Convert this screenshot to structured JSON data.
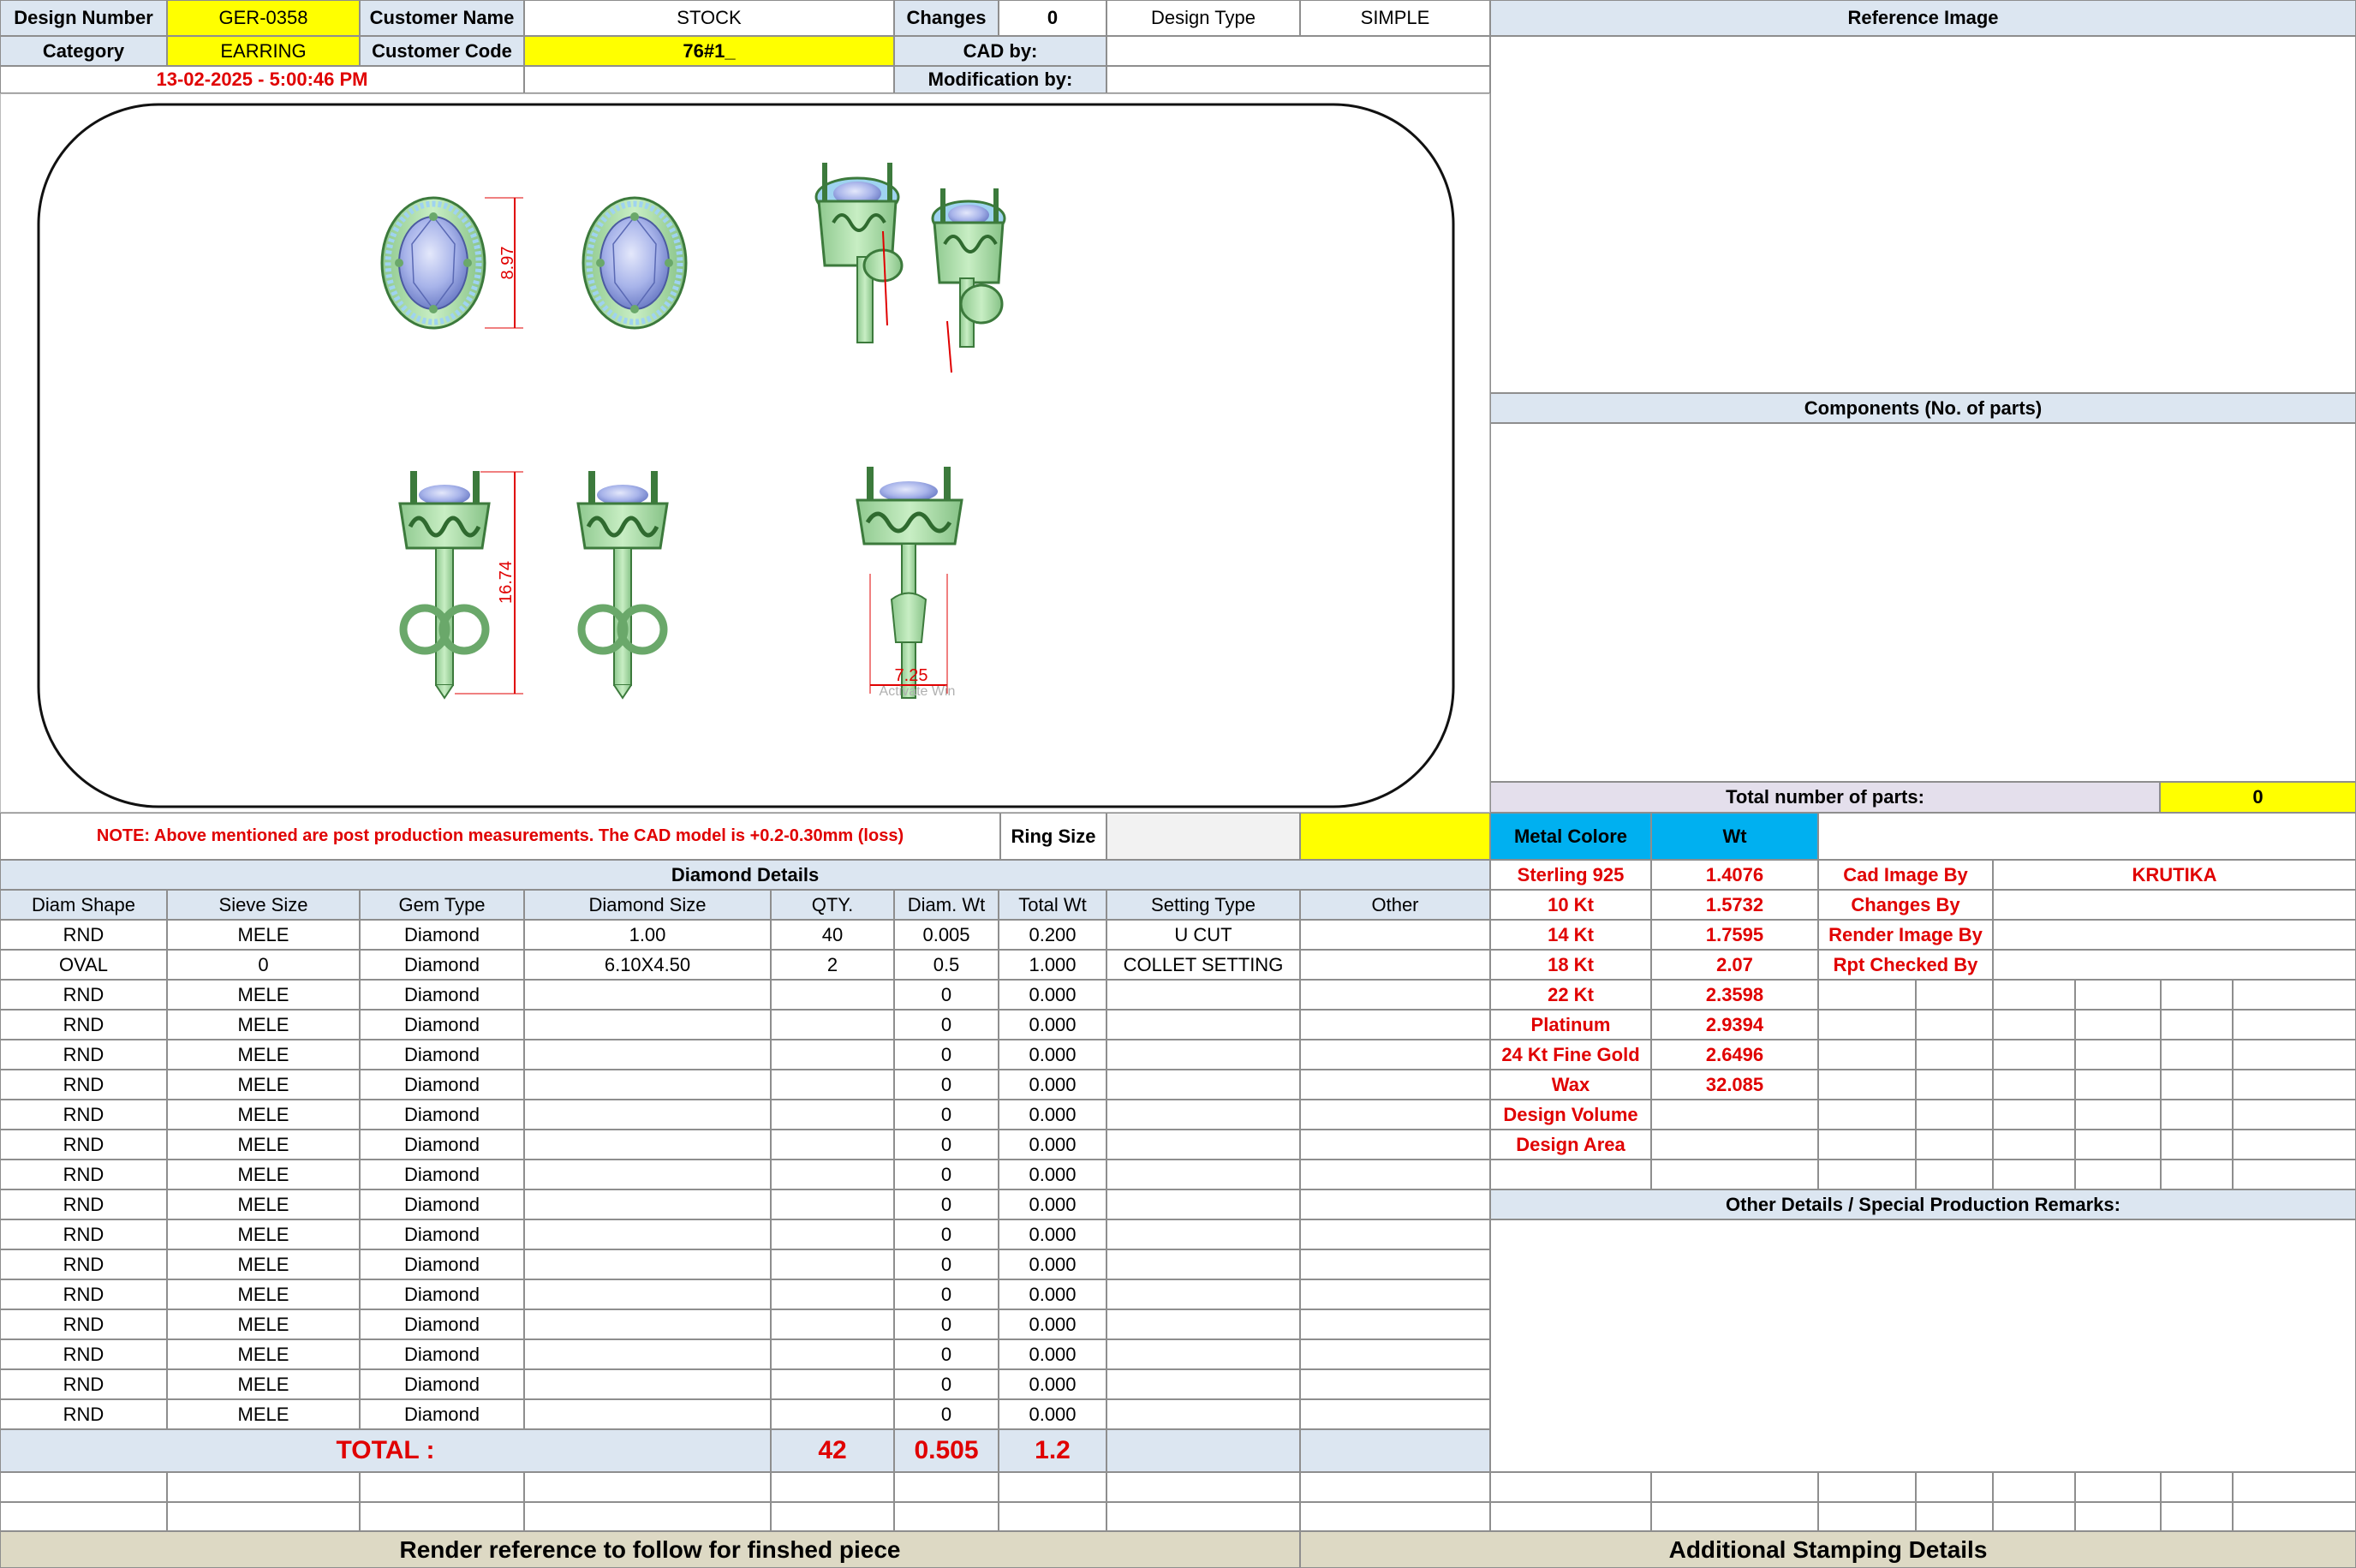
{
  "header": {
    "design_number_label": "Design Number",
    "design_number": "GER-0358",
    "customer_name_label": "Customer Name",
    "customer_name": "STOCK",
    "changes_label": "Changes",
    "changes": "0",
    "design_type_label": "Design Type",
    "design_type": "SIMPLE",
    "category_label": "Category",
    "category": "EARRING",
    "customer_code_label": "Customer Code",
    "customer_code": "76#1_",
    "cad_by_label": "CAD by:",
    "modification_by_label": "Modification by:",
    "date": "13-02-2025 - 5:00:46 PM"
  },
  "reference": {
    "title": "Reference Image",
    "components_title": "Components (No. of parts)",
    "total_parts_label": "Total number of parts:",
    "total_parts": "0"
  },
  "drawing": {
    "dim_height_front": "8.97",
    "dim_height_side": "16.74",
    "dim_width_side": "7.25",
    "watermark": "Activate Win"
  },
  "note": "NOTE: Above mentioned are post production measurements. The CAD model is +0.2-0.30mm (loss)",
  "ring_size_label": "Ring Size",
  "metal": {
    "header_label": "Metal Colore",
    "wt_label": "Wt",
    "rows": [
      {
        "name": "Sterling 925",
        "wt": "1.4076"
      },
      {
        "name": "10 Kt",
        "wt": "1.5732"
      },
      {
        "name": "14 Kt",
        "wt": "1.7595"
      },
      {
        "name": "18 Kt",
        "wt": "2.07"
      },
      {
        "name": "22 Kt",
        "wt": "2.3598"
      },
      {
        "name": "Platinum",
        "wt": "2.9394"
      },
      {
        "name": "24 Kt Fine Gold",
        "wt": "2.6496"
      },
      {
        "name": "Wax",
        "wt": "32.085"
      },
      {
        "name": "Design Volume",
        "wt": ""
      },
      {
        "name": "Design Area",
        "wt": ""
      }
    ]
  },
  "credits": [
    {
      "label": "Cad Image By",
      "value": "KRUTIKA"
    },
    {
      "label": "Changes By",
      "value": ""
    },
    {
      "label": "Render Image By",
      "value": ""
    },
    {
      "label": "Rpt Checked By",
      "value": ""
    }
  ],
  "other_details_title": "Other Details / Special Production Remarks:",
  "diamond": {
    "title": "Diamond Details",
    "columns": [
      "Diam Shape",
      "Sieve Size",
      "Gem Type",
      "Diamond Size",
      "QTY.",
      "Diam. Wt",
      "Total Wt",
      "Setting Type",
      "Other"
    ],
    "rows": [
      [
        "RND",
        "MELE",
        "Diamond",
        "1.00",
        "40",
        "0.005",
        "0.200",
        "U CUT",
        ""
      ],
      [
        "OVAL",
        "0",
        "Diamond",
        "6.10X4.50",
        "2",
        "0.5",
        "1.000",
        "COLLET SETTING",
        ""
      ],
      [
        "RND",
        "MELE",
        "Diamond",
        "",
        "",
        "0",
        "0.000",
        "",
        ""
      ],
      [
        "RND",
        "MELE",
        "Diamond",
        "",
        "",
        "0",
        "0.000",
        "",
        ""
      ],
      [
        "RND",
        "MELE",
        "Diamond",
        "",
        "",
        "0",
        "0.000",
        "",
        ""
      ],
      [
        "RND",
        "MELE",
        "Diamond",
        "",
        "",
        "0",
        "0.000",
        "",
        ""
      ],
      [
        "RND",
        "MELE",
        "Diamond",
        "",
        "",
        "0",
        "0.000",
        "",
        ""
      ],
      [
        "RND",
        "MELE",
        "Diamond",
        "",
        "",
        "0",
        "0.000",
        "",
        ""
      ],
      [
        "RND",
        "MELE",
        "Diamond",
        "",
        "",
        "0",
        "0.000",
        "",
        ""
      ],
      [
        "RND",
        "MELE",
        "Diamond",
        "",
        "",
        "0",
        "0.000",
        "",
        ""
      ],
      [
        "RND",
        "MELE",
        "Diamond",
        "",
        "",
        "0",
        "0.000",
        "",
        ""
      ],
      [
        "RND",
        "MELE",
        "Diamond",
        "",
        "",
        "0",
        "0.000",
        "",
        ""
      ],
      [
        "RND",
        "MELE",
        "Diamond",
        "",
        "",
        "0",
        "0.000",
        "",
        ""
      ],
      [
        "RND",
        "MELE",
        "Diamond",
        "",
        "",
        "0",
        "0.000",
        "",
        ""
      ],
      [
        "RND",
        "MELE",
        "Diamond",
        "",
        "",
        "0",
        "0.000",
        "",
        ""
      ],
      [
        "RND",
        "MELE",
        "Diamond",
        "",
        "",
        "0",
        "0.000",
        "",
        ""
      ],
      [
        "RND",
        "MELE",
        "Diamond",
        "",
        "",
        "0",
        "0.000",
        "",
        ""
      ]
    ],
    "total_label": "TOTAL :",
    "total_qty": "42",
    "total_diam_wt": "0.505",
    "total_wt": "1.2"
  },
  "footer": {
    "render_ref": "Render reference to follow for finshed piece",
    "stamping": "Additional Stamping Details"
  }
}
